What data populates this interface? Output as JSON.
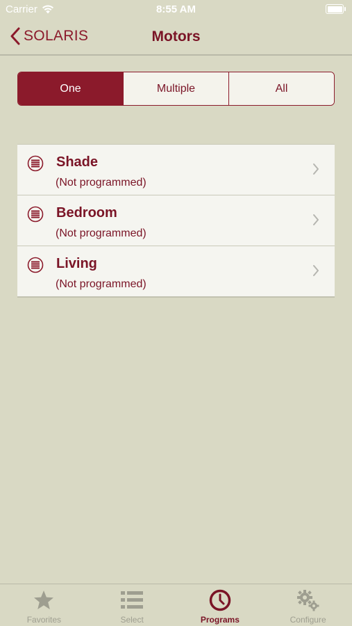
{
  "status_bar": {
    "carrier": "Carrier",
    "time": "8:55 AM",
    "battery_level": 1.0
  },
  "nav": {
    "back_label": "SOLARIS",
    "title": "Motors"
  },
  "segments": [
    {
      "label": "One",
      "active": true
    },
    {
      "label": "Multiple",
      "active": false
    },
    {
      "label": "All",
      "active": false
    }
  ],
  "motors": [
    {
      "name": "Shade",
      "status": "(Not programmed)",
      "icon": "shade-icon"
    },
    {
      "name": "Bedroom",
      "status": "(Not programmed)",
      "icon": "shade-icon"
    },
    {
      "name": "Living",
      "status": "(Not programmed)",
      "icon": "shade-icon"
    }
  ],
  "tabs": [
    {
      "label": "Favorites",
      "icon": "star-icon",
      "active": false
    },
    {
      "label": "Select",
      "icon": "list-icon",
      "active": false
    },
    {
      "label": "Programs",
      "icon": "clock-icon",
      "active": true
    },
    {
      "label": "Configure",
      "icon": "gears-icon",
      "active": false
    }
  ],
  "colors": {
    "accent": "#8b1a2b",
    "background": "#d9d9c4",
    "row_background": "#f5f5f0",
    "inactive_tab": "#9e9e90"
  }
}
